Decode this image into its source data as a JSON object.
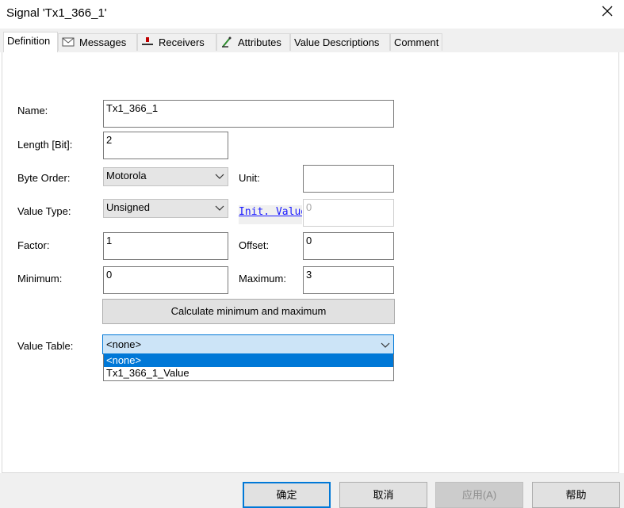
{
  "window": {
    "title": "Signal 'Tx1_366_1'",
    "close_icon": "close-icon"
  },
  "tabs": [
    {
      "label": "Definition",
      "icon": null
    },
    {
      "label": "Messages",
      "icon": "envelope-icon"
    },
    {
      "label": "Receivers",
      "icon": "receiver-icon"
    },
    {
      "label": "Attributes",
      "icon": "attributes-icon"
    },
    {
      "label": "Value Descriptions",
      "icon": null
    },
    {
      "label": "Comment",
      "icon": null
    }
  ],
  "form": {
    "name_label": "Name:",
    "name_value": "Tx1_366_1",
    "length_label": "Length [Bit]:",
    "length_value": "2",
    "byte_order_label": "Byte Order:",
    "byte_order_value": "Motorola",
    "unit_label": "Unit:",
    "unit_value": "",
    "value_type_label": "Value Type:",
    "value_type_value": "Unsigned",
    "init_value_label": "Init. Value",
    "init_value": "0",
    "factor_label": "Factor:",
    "factor_value": "1",
    "offset_label": "Offset:",
    "offset_value": "0",
    "minimum_label": "Minimum:",
    "minimum_value": "0",
    "maximum_label": "Maximum:",
    "maximum_value": "3",
    "calc_button": "Calculate minimum and maximum",
    "value_table_label": "Value Table:",
    "value_table_value": "<none>",
    "value_table_options": [
      "<none>",
      "Tx1_366_1_Value"
    ]
  },
  "footer": {
    "ok": "确定",
    "cancel": "取消",
    "apply": "应用(A)",
    "help": "帮助"
  },
  "colors": {
    "accent": "#0078d7",
    "link": "#1a1aff",
    "selection": "#cce4f7"
  }
}
